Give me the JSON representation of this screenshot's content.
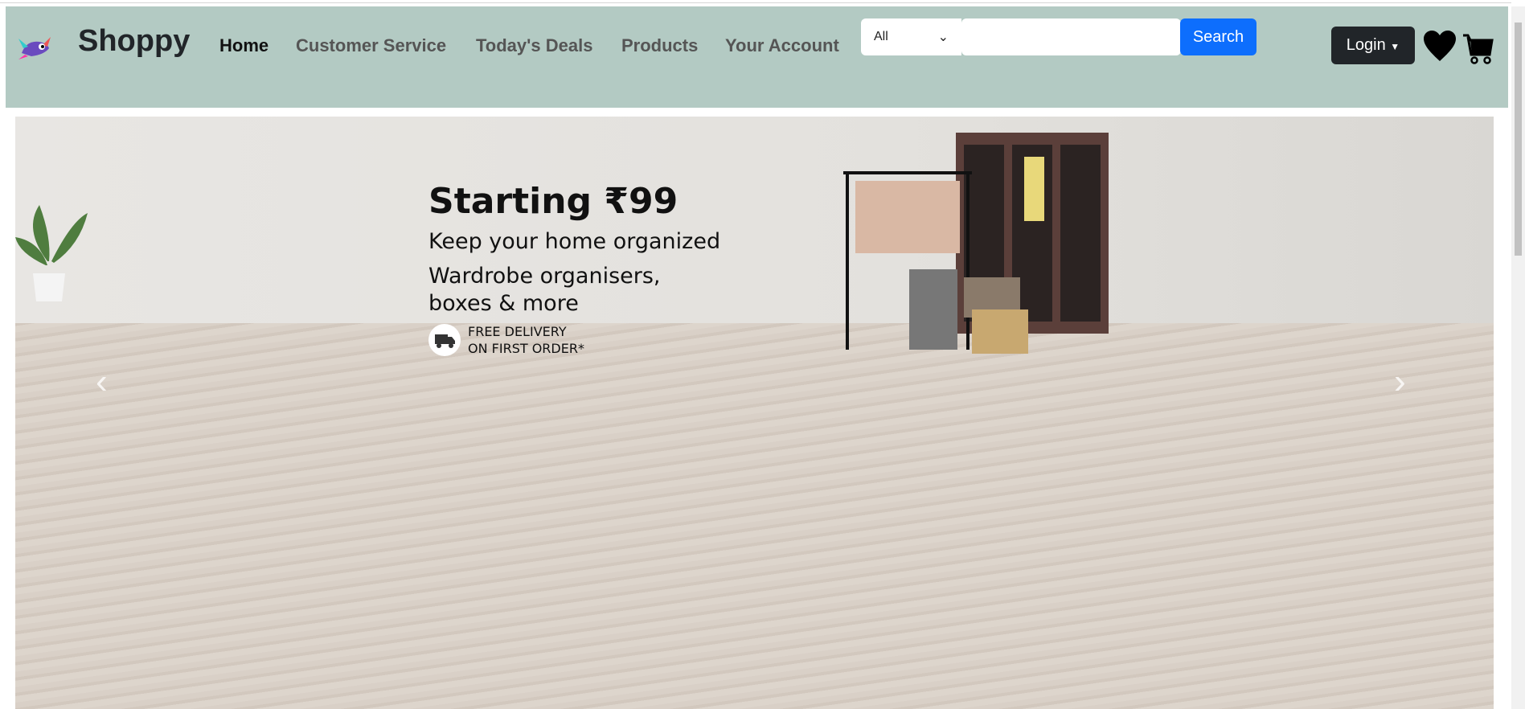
{
  "header": {
    "brand": "Shoppy",
    "nav": [
      {
        "label": "Home"
      },
      {
        "label": "Customer Service"
      },
      {
        "label": "Today's Deals"
      },
      {
        "label": "Products"
      },
      {
        "label": "Your Account"
      }
    ],
    "search": {
      "category": "All",
      "value": "",
      "button": "Search"
    },
    "login": "Login",
    "colors": {
      "header_bg": "#b3cac3",
      "search_button": "#0d6efd",
      "login_bg": "#212529"
    }
  },
  "banner": {
    "headline": "Starting ₹99",
    "subheadline": "Keep your home organized",
    "description": "Wardrobe organisers, boxes & more",
    "delivery_line1": "FREE DELIVERY",
    "delivery_line2": "ON FIRST ORDER*",
    "prev": "‹",
    "next": "›"
  }
}
